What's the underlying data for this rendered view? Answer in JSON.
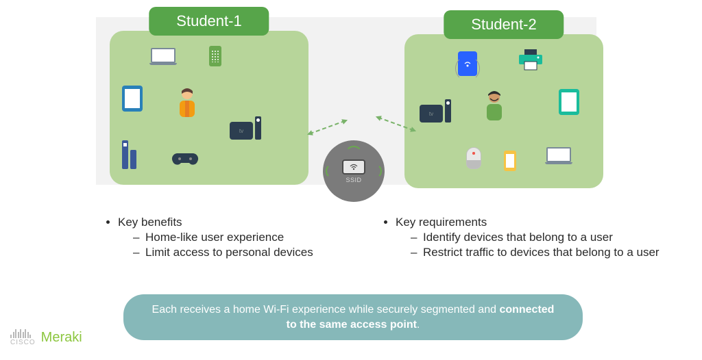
{
  "students": {
    "left": {
      "label": "Student-1"
    },
    "right": {
      "label": "Student-2"
    }
  },
  "access_point": {
    "label": "SSID"
  },
  "bullets": {
    "left": {
      "title": "Key benefits",
      "items": [
        "Home-like user experience",
        "Limit access to personal devices"
      ]
    },
    "right": {
      "title": "Key requirements",
      "items": [
        "Identify devices that belong to a user",
        "Restrict traffic to devices that belong to a user"
      ]
    }
  },
  "banner": {
    "prefix": "Each receives a home Wi-Fi experience while securely segmented and ",
    "bold": "connected to the same access point",
    "suffix": "."
  },
  "logo": {
    "brand": "CISCO",
    "sub": "Meraki"
  },
  "colors": {
    "student_box": "#b7d59a",
    "student_label": "#57a54a",
    "ap_circle": "#7b7b7b",
    "banner": "#86b8b9",
    "accent_green": "#8cc63f"
  },
  "icons": {
    "left_box": [
      "laptop",
      "phone-green",
      "tablet-blue",
      "person-orange",
      "tv-remote",
      "stick",
      "gamepad"
    ],
    "right_box": [
      "wifi-device",
      "printer",
      "tv-remote",
      "person-green",
      "tablet-teal",
      "speaker",
      "phone-yellow",
      "laptop"
    ]
  }
}
